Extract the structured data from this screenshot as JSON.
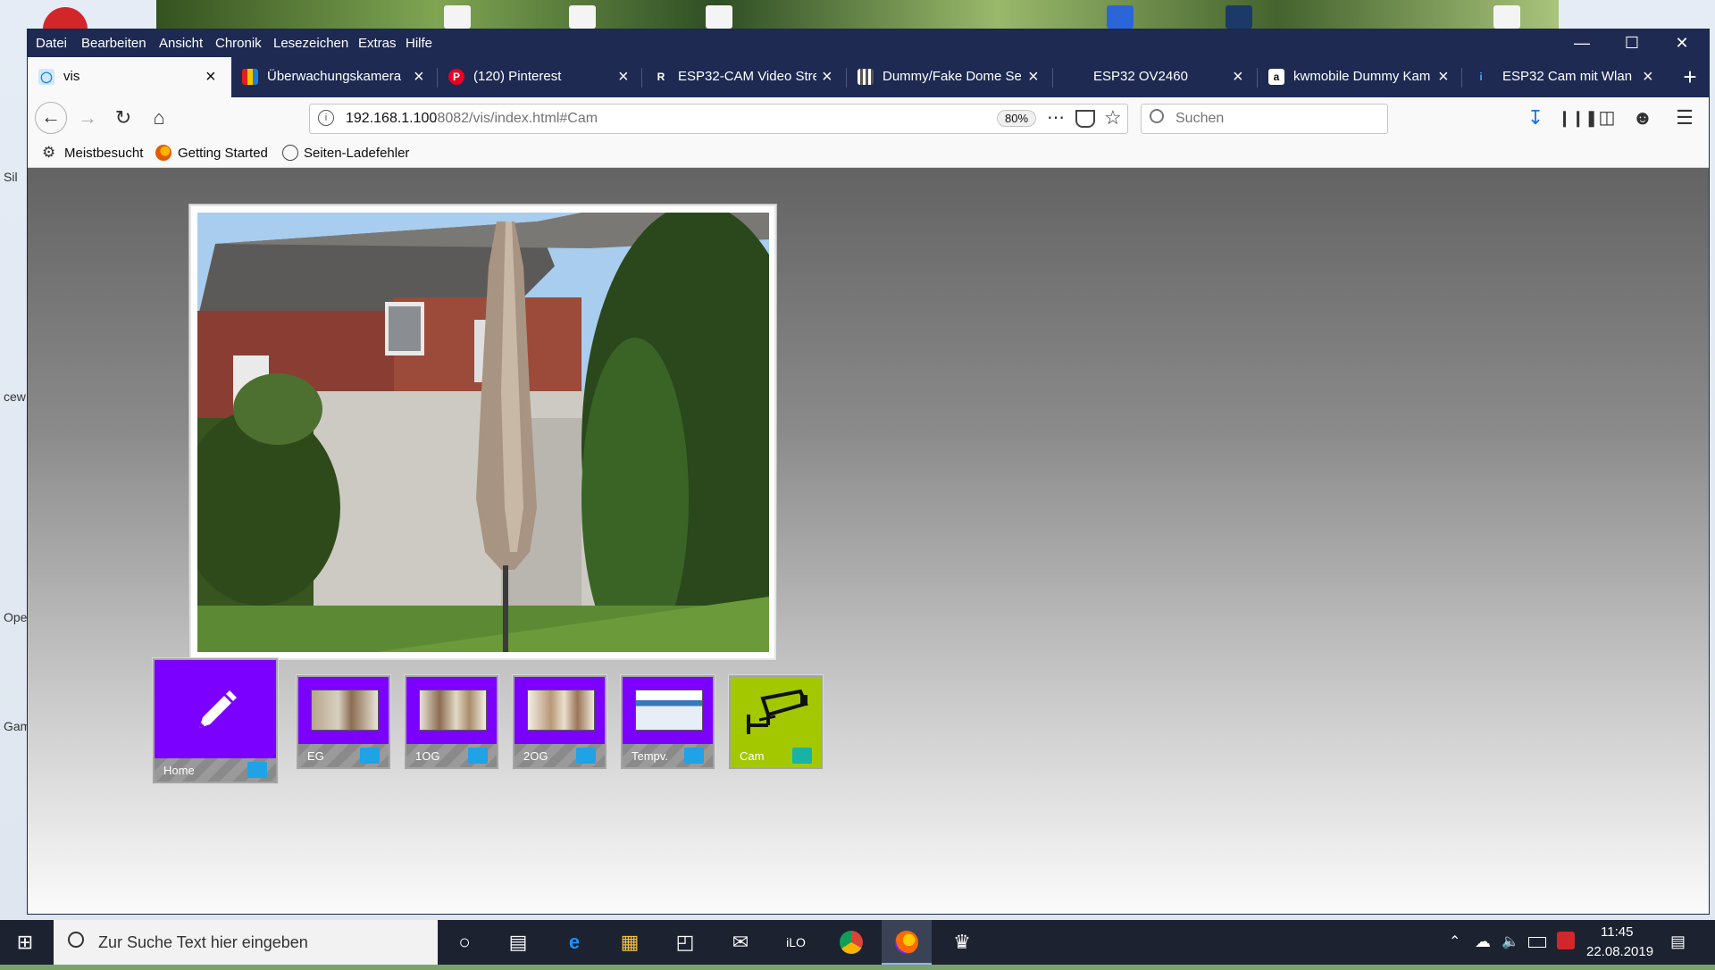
{
  "browser": {
    "menu": [
      "Datei",
      "Bearbeiten",
      "Ansicht",
      "Chronik",
      "Lesezeichen",
      "Extras",
      "Hilfe"
    ],
    "tabs": [
      {
        "label": "vis",
        "active": true
      },
      {
        "label": "Überwachungskamera"
      },
      {
        "label": "(120) Pinterest"
      },
      {
        "label": "ESP32-CAM Video Stre"
      },
      {
        "label": "Dummy/Fake Dome Se"
      },
      {
        "label": "ESP32 OV2460"
      },
      {
        "label": "kwmobile Dummy Kam"
      },
      {
        "label": "ESP32 Cam mit Wlan"
      }
    ],
    "url_host": "192.168.1.100",
    "url_rest": ":8082/vis/index.html#Cam",
    "zoom": "80%",
    "search_placeholder": "Suchen",
    "bookmarks": [
      "Meistbesucht",
      "Getting Started",
      "Seiten-Ladefehler"
    ]
  },
  "vis": {
    "tiles": [
      {
        "label": "Home",
        "color": "#7b00ff"
      },
      {
        "label": "EG",
        "color": "#7b00ff"
      },
      {
        "label": "1OG",
        "color": "#7b00ff"
      },
      {
        "label": "2OG",
        "color": "#7b00ff"
      },
      {
        "label": "Tempv.",
        "color": "#7b00ff"
      },
      {
        "label": "Cam",
        "color": "#a3c800"
      }
    ]
  },
  "desktop": {
    "left_labels": [
      "Sil",
      "cew",
      "Ope",
      "Gam"
    ]
  },
  "taskbar": {
    "search_placeholder": "Zur Suche Text hier eingeben",
    "time": "11:45",
    "date": "22.08.2019"
  }
}
